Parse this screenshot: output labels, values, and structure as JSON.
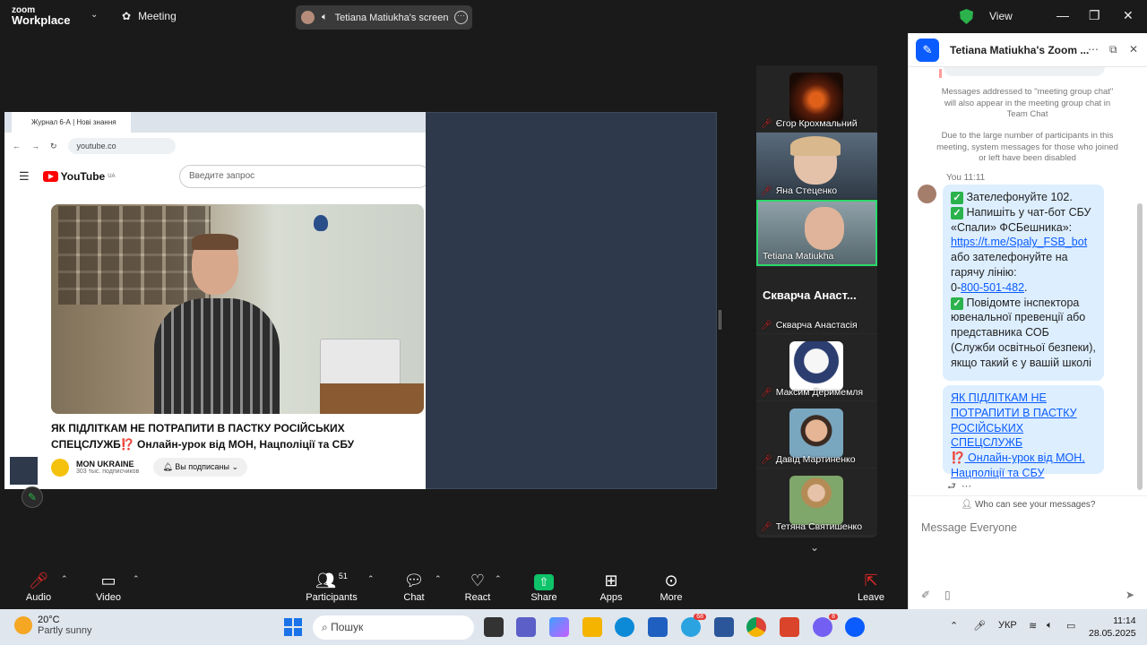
{
  "app": {
    "logo_line1": "zoom",
    "logo_line2": "Workplace",
    "meeting_label": "Meeting",
    "screen_share_label": "Tetiana Matiukha's screen",
    "view_label": "View"
  },
  "browser": {
    "tab_title": "Журнал 6-А | Нові знання",
    "address": "youtube.co",
    "search_placeholder": "Введите запрос",
    "yt_brand": "YouTube",
    "yt_region": "UA",
    "video_title": "ЯК ПІДЛІТКАМ НЕ ПОТРАПИТИ В ПАСТКУ РОСІЙСЬКИХ СПЕЦСЛУЖБ⁉️ Онлайн-урок від МОН, Нацполіції та СБУ",
    "channel_name": "MON UKRAINE",
    "channel_subs": "303 тыс. подписчиков",
    "subscribe_label": "Вы подписаны"
  },
  "participants": [
    {
      "name": "Єгор Крохмальний",
      "muted": true
    },
    {
      "name": "Яна Стеценко",
      "muted": true
    },
    {
      "name": "Tetiana Matiukha",
      "muted": false
    },
    {
      "name": "Скварча Анастасія",
      "muted": true,
      "display_big": "Скварча Анаст..."
    },
    {
      "name": "Максим Деримемля",
      "muted": true
    },
    {
      "name": "Давід Мартиненко",
      "muted": true
    },
    {
      "name": "Тетяна Святишенко",
      "muted": true
    }
  ],
  "toolbar": {
    "audio": "Audio",
    "video": "Video",
    "participants": "Participants",
    "participants_count": "51",
    "chat": "Chat",
    "react": "React",
    "share": "Share",
    "apps": "Apps",
    "more": "More",
    "leave": "Leave"
  },
  "chat": {
    "title": "Tetiana Matiukha's Zoom ...",
    "notice1": "Messages addressed to \"meeting group chat\" will also appear in the meeting group chat in Team Chat",
    "notice2": "Due to the large number of participants in this meeting, system messages for those who joined or left have been disabled",
    "sender": "You",
    "time": "11:11",
    "m1": "Зателефонуйте 102.",
    "m2a": "Напишіть у чат-бот СБУ «Спали» ФСБешника»:",
    "m2link": "https://t.me/Spaly_FSB_bot",
    "m2b": "або зателефонуйте на гарячу лінію:",
    "m2phone_prefix": "0-",
    "m2phone": "800-501-482",
    "m2end": ".",
    "m3": "Повідомте інспектора ювенальної превенції або представника СОБ (Служби освітньої безпеки), якщо такий є у вашій школі",
    "m4a": "ЯК ПІДЛІТКАМ НЕ ПОТРАПИТИ В ПАСТКУ РОСІЙСЬКИХ СПЕЦСЛУЖБ",
    "m4b": "⁉️",
    "m4c": " Онлайн-урок від МОН, Нацполіції та СБУ",
    "who_can_see": "Who can see your messages?",
    "input_placeholder": "Message Everyone"
  },
  "taskbar": {
    "temp": "20°C",
    "weather": "Partly sunny",
    "search": "Пошук",
    "lang": "УКР",
    "time": "11:14",
    "date": "28.05.2025",
    "telegram_badge": "68",
    "viber_badge": "8"
  },
  "colors": {
    "accent": "#0b5cff",
    "green": "#2bb24c",
    "muted_red": "#e02828",
    "share_green": "#0fc36a"
  }
}
